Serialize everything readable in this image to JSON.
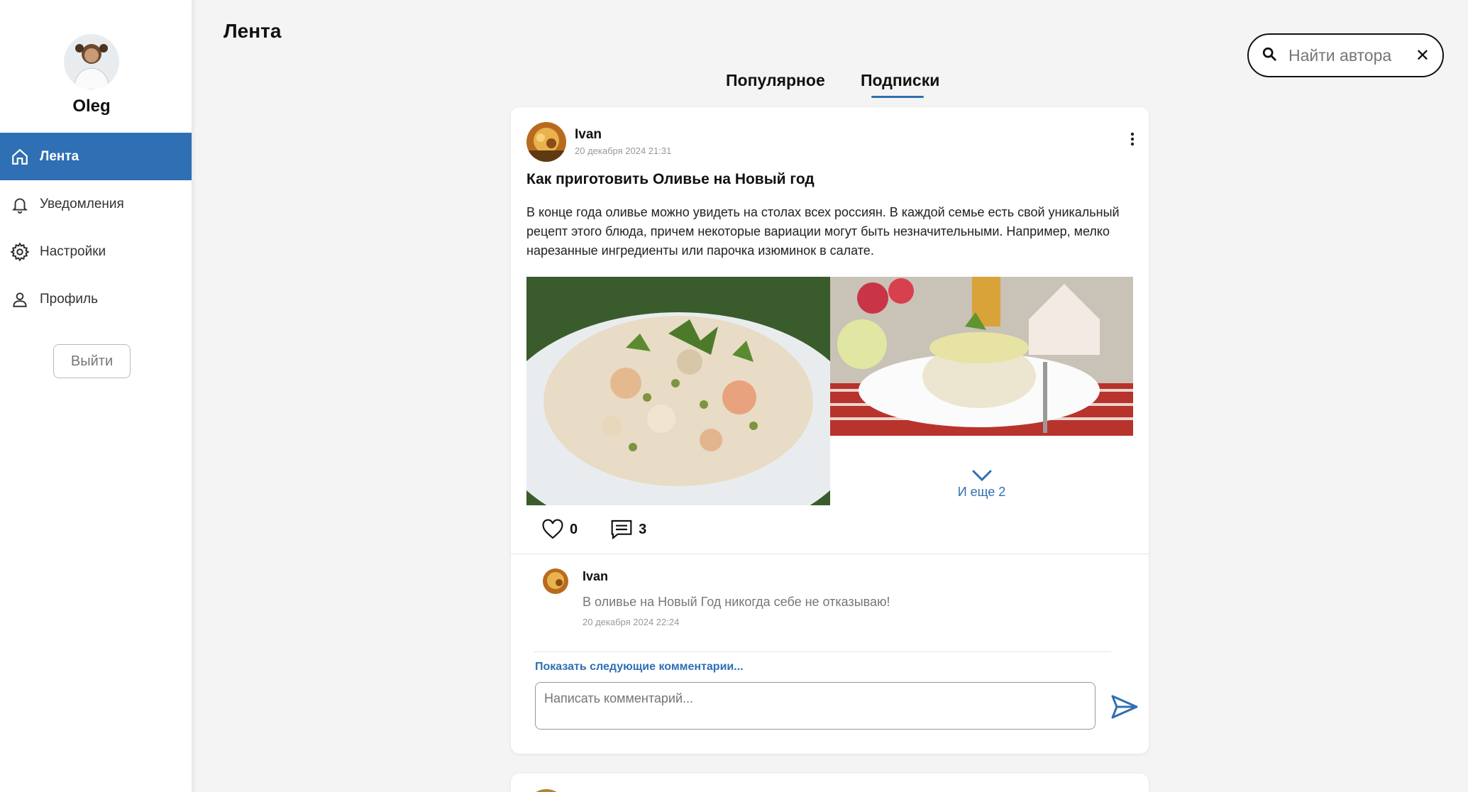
{
  "user": {
    "name": "Oleg"
  },
  "nav": {
    "items": [
      {
        "label": "Лента",
        "icon": "home-icon",
        "active": true
      },
      {
        "label": "Уведомления",
        "icon": "bell-icon"
      },
      {
        "label": "Настройки",
        "icon": "gear-icon"
      },
      {
        "label": "Профиль",
        "icon": "user-icon"
      }
    ],
    "logout_label": "Выйти"
  },
  "header": {
    "title": "Лента",
    "search_placeholder": "Найти автора"
  },
  "tabs": [
    {
      "label": "Популярное",
      "active": false
    },
    {
      "label": "Подписки",
      "active": true
    }
  ],
  "post": {
    "author": "Ivan",
    "date": "20 декабря 2024 21:31",
    "title": "Как приготовить Оливье на Новый год",
    "text": "В конце года оливье можно увидеть на столах всех россиян. В каждой семье есть свой уникальный рецепт этого блюда, причем некоторые вариации могут быть незначительными. Например, мелко нарезанные ингредиенты или парочка изюминок в салате.",
    "more_images_label": "И еще 2",
    "likes": "0",
    "comments_count": "3",
    "comment": {
      "author": "Ivan",
      "text": "В оливье на Новый Год никогда себе не отказываю!",
      "date": "20 декабря 2024 22:24"
    },
    "show_more_comments": "Показать следующие комментарии...",
    "comment_placeholder": "Написать комментарий..."
  },
  "colors": {
    "accent": "#2f6fb3",
    "background": "#f4f4f4"
  }
}
